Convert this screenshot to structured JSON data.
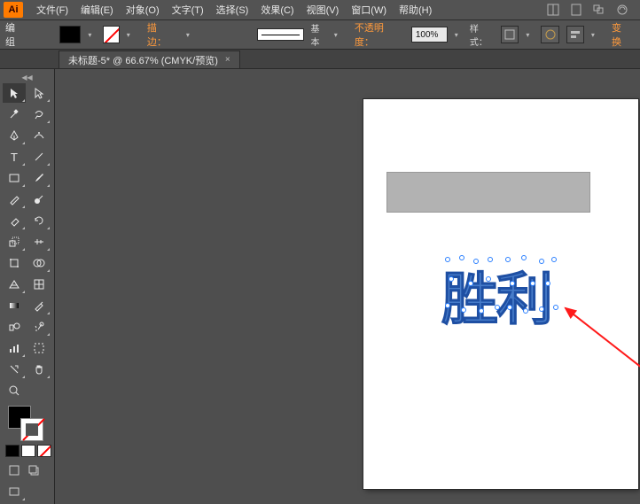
{
  "menu": {
    "items": [
      "文件(F)",
      "编辑(E)",
      "对象(O)",
      "文字(T)",
      "选择(S)",
      "效果(C)",
      "视图(V)",
      "窗口(W)",
      "帮助(H)"
    ]
  },
  "control": {
    "label": "编组",
    "stroke_label": "描边：",
    "blend_label": "基本",
    "opacity_label": "不透明度：",
    "opacity_value": "100%",
    "style_label": "样式：",
    "transform_label": "变换"
  },
  "tabs": {
    "doc_title": "未标题-5* @ 66.67% (CMYK/预览)"
  },
  "canvas": {
    "text": "胜利"
  }
}
